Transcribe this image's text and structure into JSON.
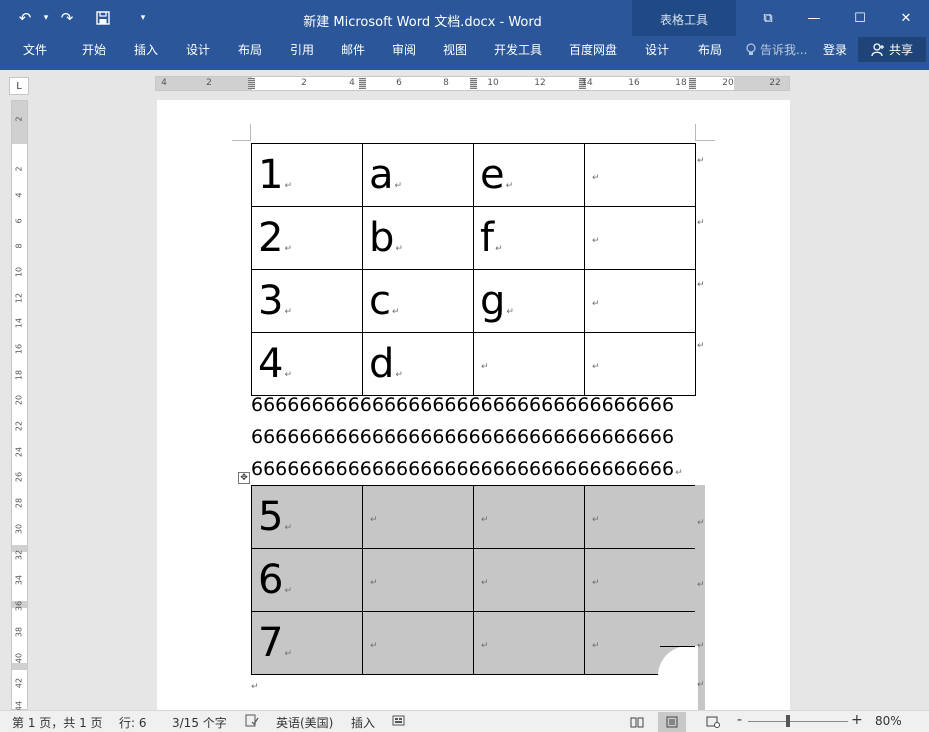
{
  "window": {
    "title": "新建 Microsoft Word 文档.docx - Word",
    "context_tab_group": "表格工具",
    "controls": {
      "ribbon_options": "⧉",
      "minimize": "—",
      "maximize": "☐",
      "close": "✕"
    }
  },
  "qat": {
    "undo": "↶",
    "undo_dropdown": "▾",
    "redo": "↷",
    "save": "💾",
    "customize": "▾"
  },
  "ribbon": {
    "tabs": [
      "文件",
      "开始",
      "插入",
      "设计",
      "布局",
      "引用",
      "邮件",
      "审阅",
      "视图",
      "开发工具",
      "百度网盘",
      "设计",
      "布局"
    ],
    "tell_me": "告诉我...",
    "login": "登录",
    "share": "共享"
  },
  "ruler": {
    "corner": "L",
    "h_numbers": [
      "4",
      "2",
      "2",
      "4",
      "6",
      "8",
      "10",
      "12",
      "14",
      "16",
      "18",
      "20",
      "22"
    ],
    "v_numbers": [
      "2",
      "2",
      "4",
      "6",
      "8",
      "10",
      "12",
      "14",
      "16",
      "18",
      "20",
      "22",
      "24",
      "26",
      "28",
      "30",
      "32",
      "34",
      "36",
      "38",
      "40",
      "42",
      "44"
    ]
  },
  "document": {
    "table1": [
      [
        "1",
        "a",
        "e",
        ""
      ],
      [
        "2",
        "b",
        "f",
        ""
      ],
      [
        "3",
        "c",
        "g",
        ""
      ],
      [
        "4",
        "d",
        "",
        ""
      ]
    ],
    "paragraph_lines": [
      "66666666666666666666666666666666666",
      "66666666666666666666666666666666666",
      "66666666666666666666666666666666666"
    ],
    "table2": [
      [
        "5",
        "",
        "",
        ""
      ],
      [
        "6",
        "",
        "",
        ""
      ],
      [
        "7",
        "",
        "",
        ""
      ]
    ],
    "paragraph_mark": "↵",
    "table_move_handle": "✥"
  },
  "statusbar": {
    "page": "第 1 页，共 1 页",
    "words": "行: 6",
    "chars": "3/15 个字",
    "language": "英语(美国)",
    "mode": "插入",
    "zoom": "80%",
    "zoom_minus": "-",
    "zoom_plus": "+"
  },
  "colors": {
    "title_bar": "#2b579a",
    "context_header": "#204a85",
    "table_selection": "#c6c6c6"
  }
}
